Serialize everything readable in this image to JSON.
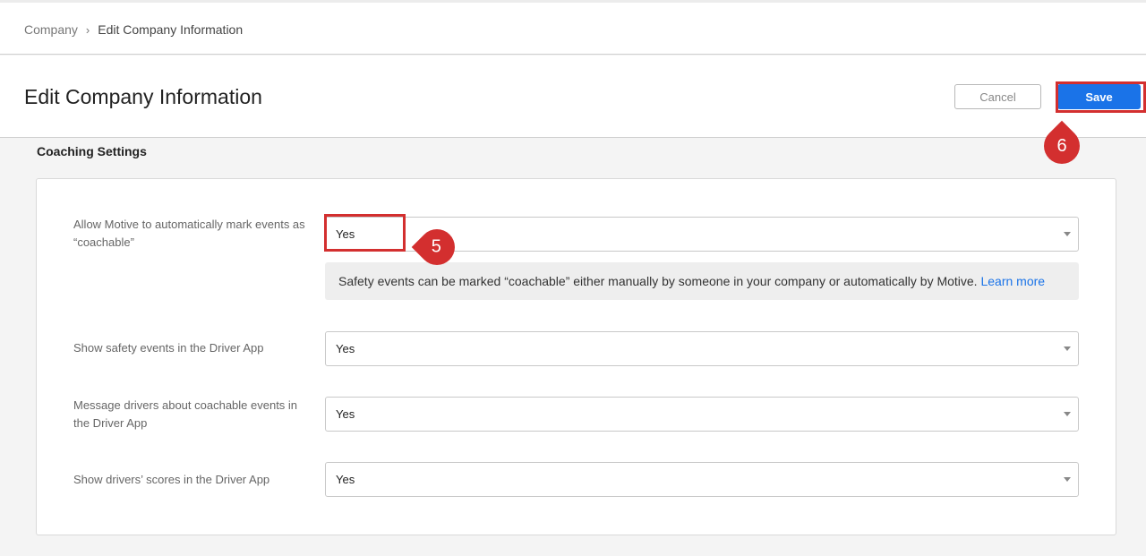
{
  "breadcrumb": {
    "parent": "Company",
    "separator": "›",
    "current": "Edit Company Information"
  },
  "header": {
    "title": "Edit Company Information",
    "cancel_label": "Cancel",
    "save_label": "Save"
  },
  "section": {
    "title": "Coaching Settings"
  },
  "settings": [
    {
      "label": "Allow Motive to automatically mark events as “coachable”",
      "value": "Yes"
    },
    {
      "label": "Show safety events in the Driver App",
      "value": "Yes"
    },
    {
      "label": "Message drivers about coachable events in the Driver App",
      "value": "Yes"
    },
    {
      "label": "Show drivers’ scores in the Driver App",
      "value": "Yes"
    }
  ],
  "info": {
    "text": "Safety events can be marked “coachable” either manually by someone in your company or automatically by Motive.",
    "link": "Learn more"
  },
  "markers": {
    "step5": "5",
    "step6": "6"
  },
  "colors": {
    "primary": "#1a73e8",
    "highlight": "#d32f2f"
  },
  "icons": {
    "breadcrumb_separator": "chevron-right-icon",
    "select_caret": "caret-down-icon"
  }
}
